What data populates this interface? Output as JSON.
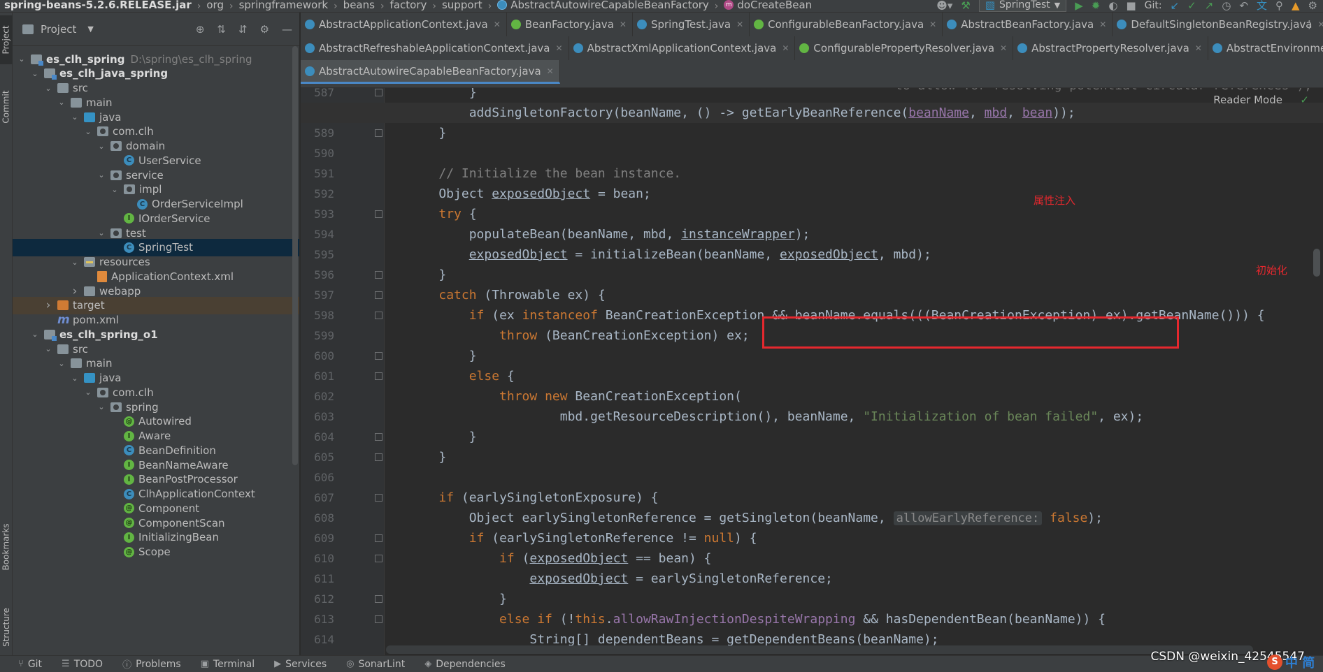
{
  "breadcrumbs": [
    {
      "label": "spring-beans-5.2.6.RELEASE.jar",
      "icon": "jar-icon"
    },
    {
      "label": "org",
      "icon": "package-icon"
    },
    {
      "label": "springframework",
      "icon": "package-icon"
    },
    {
      "label": "beans",
      "icon": "package-icon"
    },
    {
      "label": "factory",
      "icon": "package-icon"
    },
    {
      "label": "support",
      "icon": "package-icon"
    },
    {
      "label": "AbstractAutowireCapableBeanFactory",
      "icon": "class-icon"
    },
    {
      "label": "doCreateBean",
      "icon": "method-icon"
    }
  ],
  "toolbar": {
    "run_config": "SpringTest",
    "git_label": "Git:"
  },
  "left_strip": {
    "project": "Project",
    "commit": "Commit",
    "bookmarks": "Bookmarks",
    "structure": "Structure"
  },
  "project_panel": {
    "title": "Project",
    "tree": [
      {
        "label": "es_clh_spring",
        "path": "D:\\spring\\es_clh_spring",
        "icon": "module-icon",
        "depth": 0,
        "arrow": "down",
        "bold": true
      },
      {
        "label": "es_clh_java_spring",
        "icon": "module-icon",
        "depth": 1,
        "arrow": "down",
        "bold": true
      },
      {
        "label": "src",
        "icon": "folder-icon",
        "depth": 2,
        "arrow": "down"
      },
      {
        "label": "main",
        "icon": "folder-icon",
        "depth": 3,
        "arrow": "down"
      },
      {
        "label": "java",
        "icon": "source-folder-icon",
        "depth": 4,
        "arrow": "down"
      },
      {
        "label": "com.clh",
        "icon": "package-icon",
        "depth": 5,
        "arrow": "down"
      },
      {
        "label": "domain",
        "icon": "package-icon",
        "depth": 6,
        "arrow": "down"
      },
      {
        "label": "UserService",
        "icon": "class-icon",
        "depth": 7,
        "arrow": "none"
      },
      {
        "label": "service",
        "icon": "package-icon",
        "depth": 6,
        "arrow": "down"
      },
      {
        "label": "impl",
        "icon": "package-icon",
        "depth": 7,
        "arrow": "down"
      },
      {
        "label": "OrderServiceImpl",
        "icon": "class-icon",
        "depth": 8,
        "arrow": "none"
      },
      {
        "label": "IOrderService",
        "icon": "interface-icon",
        "depth": 7,
        "arrow": "none"
      },
      {
        "label": "test",
        "icon": "package-icon",
        "depth": 6,
        "arrow": "down"
      },
      {
        "label": "SpringTest",
        "icon": "class-icon",
        "depth": 7,
        "arrow": "none",
        "selected": true
      },
      {
        "label": "resources",
        "icon": "resources-folder-icon",
        "depth": 4,
        "arrow": "down"
      },
      {
        "label": "ApplicationContext.xml",
        "icon": "xml-file-icon",
        "depth": 5,
        "arrow": "none"
      },
      {
        "label": "webapp",
        "icon": "folder-icon",
        "depth": 4,
        "arrow": "right"
      },
      {
        "label": "target",
        "icon": "excluded-folder-icon",
        "depth": 2,
        "arrow": "right",
        "excluded": true
      },
      {
        "label": "pom.xml",
        "icon": "maven-icon",
        "depth": 2,
        "arrow": "none"
      },
      {
        "label": "es_clh_spring_o1",
        "icon": "module-icon",
        "depth": 1,
        "arrow": "down",
        "bold": true
      },
      {
        "label": "src",
        "icon": "folder-icon",
        "depth": 2,
        "arrow": "down"
      },
      {
        "label": "main",
        "icon": "folder-icon",
        "depth": 3,
        "arrow": "down"
      },
      {
        "label": "java",
        "icon": "source-folder-icon",
        "depth": 4,
        "arrow": "down"
      },
      {
        "label": "com.clh",
        "icon": "package-icon",
        "depth": 5,
        "arrow": "down"
      },
      {
        "label": "spring",
        "icon": "package-icon",
        "depth": 6,
        "arrow": "down"
      },
      {
        "label": "Autowired",
        "icon": "annotation-icon",
        "depth": 7,
        "arrow": "none"
      },
      {
        "label": "Aware",
        "icon": "interface-icon",
        "depth": 7,
        "arrow": "none"
      },
      {
        "label": "BeanDefinition",
        "icon": "class-icon",
        "depth": 7,
        "arrow": "none"
      },
      {
        "label": "BeanNameAware",
        "icon": "interface-icon",
        "depth": 7,
        "arrow": "none"
      },
      {
        "label": "BeanPostProcessor",
        "icon": "interface-icon",
        "depth": 7,
        "arrow": "none"
      },
      {
        "label": "ClhApplicationContext",
        "icon": "class-icon",
        "depth": 7,
        "arrow": "none"
      },
      {
        "label": "Component",
        "icon": "annotation-icon",
        "depth": 7,
        "arrow": "none"
      },
      {
        "label": "ComponentScan",
        "icon": "annotation-icon",
        "depth": 7,
        "arrow": "none"
      },
      {
        "label": "InitializingBean",
        "icon": "interface-icon",
        "depth": 7,
        "arrow": "none"
      },
      {
        "label": "Scope",
        "icon": "annotation-icon",
        "depth": 7,
        "arrow": "none"
      }
    ]
  },
  "tabs": {
    "rows": [
      [
        {
          "label": "AbstractApplicationContext.java",
          "icon": "class-icon"
        },
        {
          "label": "BeanFactory.java",
          "icon": "interface-icon"
        },
        {
          "label": "SpringTest.java",
          "icon": "class-icon"
        },
        {
          "label": "ConfigurableBeanFactory.java",
          "icon": "interface-icon"
        },
        {
          "label": "AbstractBeanFactory.java",
          "icon": "class-icon"
        },
        {
          "label": "DefaultSingletonBeanRegistry.java",
          "icon": "class-icon"
        }
      ],
      [
        {
          "label": "AbstractRefreshableApplicationContext.java",
          "icon": "class-icon"
        },
        {
          "label": "AbstractXmlApplicationContext.java",
          "icon": "class-icon"
        },
        {
          "label": "ConfigurablePropertyResolver.java",
          "icon": "interface-icon"
        },
        {
          "label": "AbstractPropertyResolver.java",
          "icon": "class-icon"
        },
        {
          "label": "AbstractEnvironment.java",
          "icon": "class-icon"
        }
      ],
      [
        {
          "label": "AbstractAutowireCapableBeanFactory.java",
          "icon": "class-icon",
          "active": true
        }
      ]
    ]
  },
  "editor": {
    "reader_mode": "Reader Mode",
    "partial_top_line": "to allow for resolving potential circular references\");",
    "lines": [
      {
        "n": "587",
        "html": "        }"
      },
      {
        "n": "588",
        "current": true,
        "html": "        addSingletonFactory(beanName, () -> getEarlyBeanReference(<span class='fldul'>beanName</span>, <span class='fldul'>mbd</span>, <span class='fldul'>bean</span>));"
      },
      {
        "n": "589",
        "html": "    }"
      },
      {
        "n": "590",
        "html": ""
      },
      {
        "n": "591",
        "html": "    <span class='cm'>// Initialize the bean instance.</span>"
      },
      {
        "n": "592",
        "html": "    Object <span class='ul'>exposedObject</span> = bean;"
      },
      {
        "n": "593",
        "html": "    <span class='kw'>try</span> {"
      },
      {
        "n": "594",
        "html": "        populateBean(beanName, mbd, <span class='ul'>instanceWrapper</span>);"
      },
      {
        "n": "595",
        "html": "        <span class='ul'>exposedObject</span> = initializeBean(beanName, <span class='ul'>exposedObject</span>, mbd);"
      },
      {
        "n": "596",
        "html": "    }"
      },
      {
        "n": "597",
        "html": "    <span class='kw'>catch</span> (Throwable ex) {"
      },
      {
        "n": "598",
        "html": "        <span class='kw'>if</span> (ex <span class='kw'>instanceof</span> BeanCreationException &amp;&amp; beanName.equals(((BeanCreationException) ex).getBeanName())) {"
      },
      {
        "n": "599",
        "html": "            <span class='kw'>throw</span> (BeanCreationException) ex;"
      },
      {
        "n": "600",
        "html": "        }"
      },
      {
        "n": "601",
        "html": "        <span class='kw'>else</span> {"
      },
      {
        "n": "602",
        "html": "            <span class='kw'>throw new</span> BeanCreationException("
      },
      {
        "n": "603",
        "html": "                    mbd.getResourceDescription(), beanName, <span class='str'>\"Initialization of bean failed\"</span>, ex);"
      },
      {
        "n": "604",
        "html": "        }"
      },
      {
        "n": "605",
        "html": "    }"
      },
      {
        "n": "606",
        "html": ""
      },
      {
        "n": "607",
        "html": "    <span class='kw'>if</span> (earlySingletonExposure) {"
      },
      {
        "n": "608",
        "html": "        Object earlySingletonReference = getSingleton(beanName, <span class='hint'>allowEarlyReference:</span> <span class='kw'>false</span>);"
      },
      {
        "n": "609",
        "html": "        <span class='kw'>if</span> (earlySingletonReference != <span class='kw'>null</span>) {"
      },
      {
        "n": "610",
        "html": "            <span class='kw'>if</span> (<span class='ul'>exposedObject</span> == bean) {"
      },
      {
        "n": "611",
        "html": "                <span class='ul'>exposedObject</span> = earlySingletonReference;"
      },
      {
        "n": "612",
        "html": "            }"
      },
      {
        "n": "613",
        "html": "            <span class='kw'>else if</span> (!<span class='kw'>this</span>.<span class='fld'>allowRawInjectionDespiteWrapping</span> &amp;&amp; hasDependentBean(beanName)) {"
      },
      {
        "n": "614",
        "html": "                String[] dependentBeans = getDependentBeans(beanName);"
      }
    ],
    "annotations": {
      "property_injection": "属性注入",
      "initialization": "初始化"
    }
  },
  "status_bar": [
    {
      "label": "Git",
      "icon": "git-branch-icon"
    },
    {
      "label": "TODO",
      "icon": "todo-list-icon"
    },
    {
      "label": "Problems",
      "icon": "problems-icon"
    },
    {
      "label": "Terminal",
      "icon": "terminal-icon"
    },
    {
      "label": "Services",
      "icon": "services-icon"
    },
    {
      "label": "SonarLint",
      "icon": "sonarlint-icon"
    },
    {
      "label": "Dependencies",
      "icon": "dependencies-icon"
    }
  ],
  "watermark": "CSDN @weixin_42545547",
  "corner_badge": {
    "s": "S",
    "text": "中 简"
  }
}
